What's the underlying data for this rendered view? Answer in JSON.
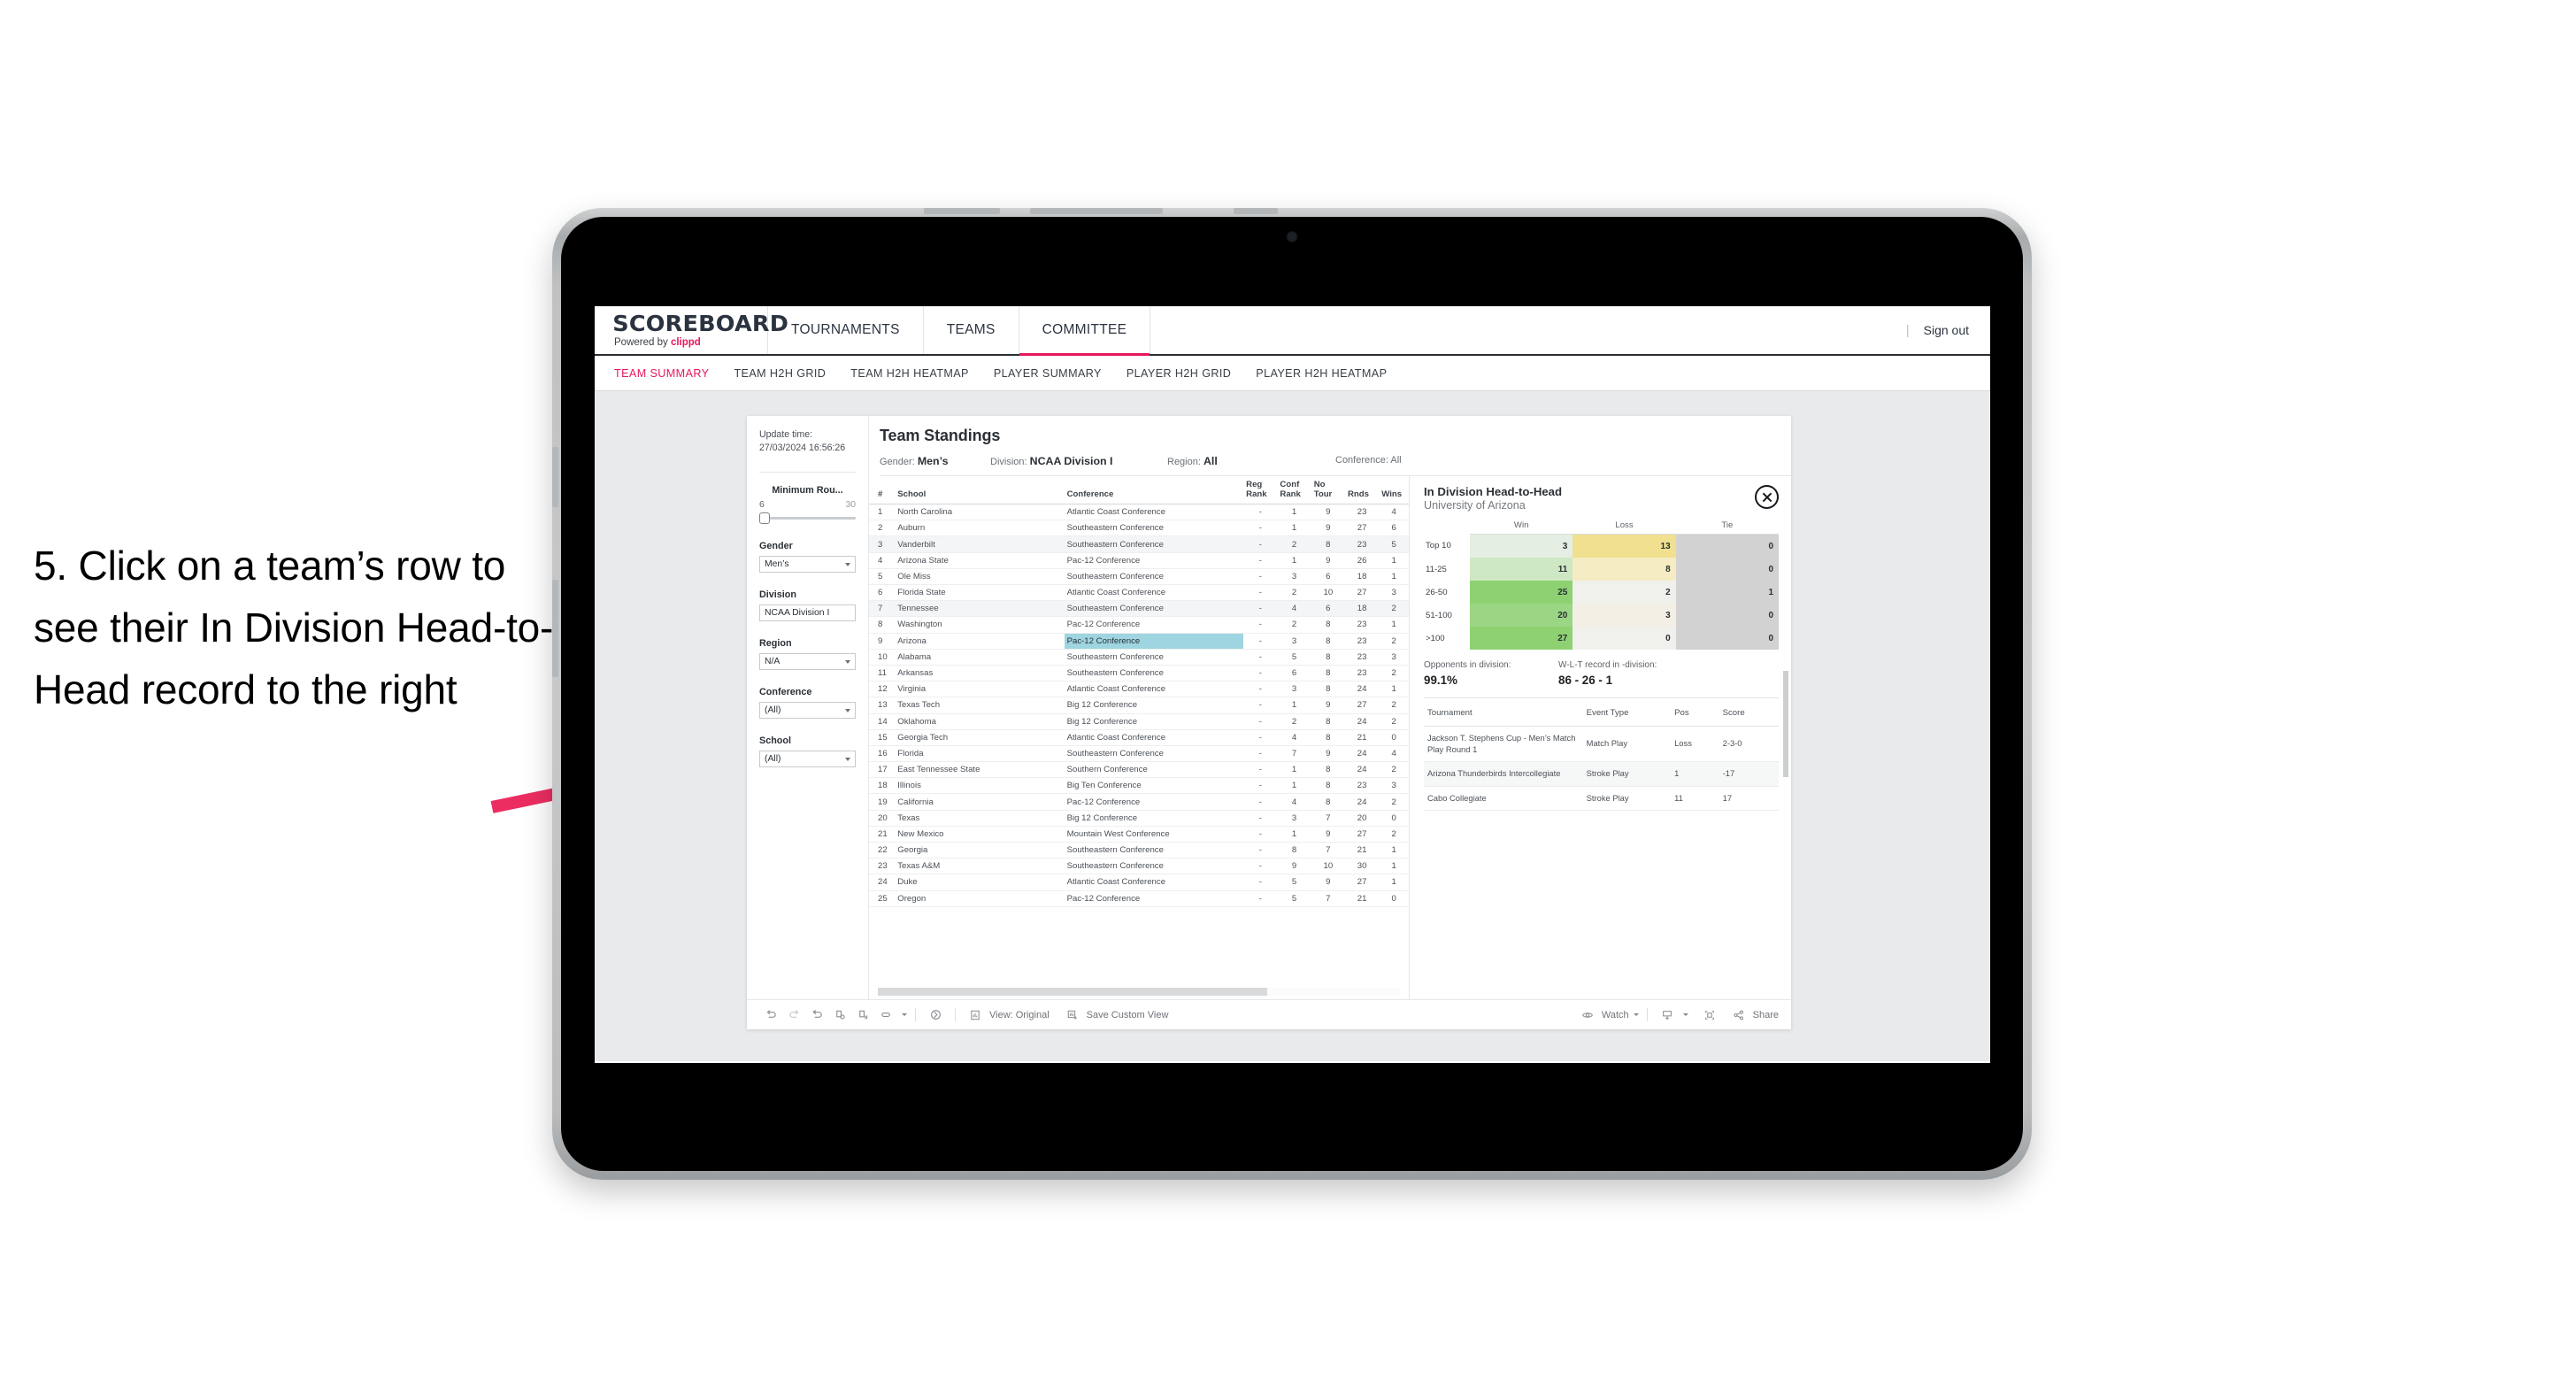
{
  "annotation": {
    "text": "5. Click on a team’s row to see their In Division Head-to-Head record to the right",
    "arrow_color": "#ec2d62"
  },
  "app": {
    "brand": {
      "name": "SCOREBOARD",
      "powered_prefix": "Powered by ",
      "powered_brand": "clippd"
    },
    "nav": [
      {
        "label": "TOURNAMENTS",
        "active": false
      },
      {
        "label": "TEAMS",
        "active": false
      },
      {
        "label": "COMMITTEE",
        "active": true
      }
    ],
    "nav_divider": "|",
    "sign_out": "Sign out",
    "subnav": [
      {
        "label": "TEAM SUMMARY",
        "active": true
      },
      {
        "label": "TEAM H2H GRID",
        "active": false
      },
      {
        "label": "TEAM H2H HEATMAP",
        "active": false
      },
      {
        "label": "PLAYER SUMMARY",
        "active": false
      },
      {
        "label": "PLAYER H2H GRID",
        "active": false
      },
      {
        "label": "PLAYER H2H HEATMAP",
        "active": false
      }
    ]
  },
  "rail": {
    "update_label": "Update time:",
    "update_value": "27/03/2024 16:56:26",
    "min_rounds": {
      "title": "Minimum Rou...",
      "min": "6",
      "max": "30"
    },
    "filters": [
      {
        "title": "Gender",
        "value": "Men’s",
        "caret": true
      },
      {
        "title": "Division",
        "value": "NCAA Division I",
        "caret": false
      },
      {
        "title": "Region",
        "value": "N/A",
        "caret": true
      },
      {
        "title": "Conference",
        "value": "(All)",
        "caret": true
      },
      {
        "title": "School",
        "value": "(All)",
        "caret": true
      }
    ]
  },
  "standings": {
    "title": "Team Standings",
    "filters": [
      {
        "key": "Gender:",
        "value": "Men’s"
      },
      {
        "key": "Division:",
        "value": "NCAA Division I"
      },
      {
        "key": "Region:",
        "value": "All"
      },
      {
        "key": "Conference:",
        "value": "All"
      }
    ],
    "columns": [
      "#",
      "School",
      "Conference",
      "Reg Rank",
      "Conf Rank",
      "No Tour",
      "Rnds",
      "Wins"
    ],
    "column_head_lines": [
      [
        "#"
      ],
      [
        "School"
      ],
      [
        "Conference"
      ],
      [
        "Reg",
        "Rank"
      ],
      [
        "Conf",
        "Rank"
      ],
      [
        "No",
        "Tour"
      ],
      [
        "Rnds"
      ],
      [
        "Wins"
      ]
    ],
    "selected_rank": 9,
    "rows": [
      {
        "rank": "1",
        "school": "North Carolina",
        "conference": "Atlantic Coast Conference",
        "reg_rank": "-",
        "conf_rank": "1",
        "no_tour": "9",
        "rnds": "23",
        "wins": "4"
      },
      {
        "rank": "2",
        "school": "Auburn",
        "conference": "Southeastern Conference",
        "reg_rank": "-",
        "conf_rank": "1",
        "no_tour": "9",
        "rnds": "27",
        "wins": "6"
      },
      {
        "rank": "3",
        "school": "Vanderbilt",
        "conference": "Southeastern Conference",
        "reg_rank": "-",
        "conf_rank": "2",
        "no_tour": "8",
        "rnds": "23",
        "wins": "5"
      },
      {
        "rank": "4",
        "school": "Arizona State",
        "conference": "Pac-12 Conference",
        "reg_rank": "-",
        "conf_rank": "1",
        "no_tour": "9",
        "rnds": "26",
        "wins": "1"
      },
      {
        "rank": "5",
        "school": "Ole Miss",
        "conference": "Southeastern Conference",
        "reg_rank": "-",
        "conf_rank": "3",
        "no_tour": "6",
        "rnds": "18",
        "wins": "1"
      },
      {
        "rank": "6",
        "school": "Florida State",
        "conference": "Atlantic Coast Conference",
        "reg_rank": "-",
        "conf_rank": "2",
        "no_tour": "10",
        "rnds": "27",
        "wins": "3"
      },
      {
        "rank": "7",
        "school": "Tennessee",
        "conference": "Southeastern Conference",
        "reg_rank": "-",
        "conf_rank": "4",
        "no_tour": "6",
        "rnds": "18",
        "wins": "2"
      },
      {
        "rank": "8",
        "school": "Washington",
        "conference": "Pac-12 Conference",
        "reg_rank": "-",
        "conf_rank": "2",
        "no_tour": "8",
        "rnds": "23",
        "wins": "1"
      },
      {
        "rank": "9",
        "school": "Arizona",
        "conference": "Pac-12 Conference",
        "reg_rank": "-",
        "conf_rank": "3",
        "no_tour": "8",
        "rnds": "23",
        "wins": "2"
      },
      {
        "rank": "10",
        "school": "Alabama",
        "conference": "Southeastern Conference",
        "reg_rank": "-",
        "conf_rank": "5",
        "no_tour": "8",
        "rnds": "23",
        "wins": "3"
      },
      {
        "rank": "11",
        "school": "Arkansas",
        "conference": "Southeastern Conference",
        "reg_rank": "-",
        "conf_rank": "6",
        "no_tour": "8",
        "rnds": "23",
        "wins": "2"
      },
      {
        "rank": "12",
        "school": "Virginia",
        "conference": "Atlantic Coast Conference",
        "reg_rank": "-",
        "conf_rank": "3",
        "no_tour": "8",
        "rnds": "24",
        "wins": "1"
      },
      {
        "rank": "13",
        "school": "Texas Tech",
        "conference": "Big 12 Conference",
        "reg_rank": "-",
        "conf_rank": "1",
        "no_tour": "9",
        "rnds": "27",
        "wins": "2"
      },
      {
        "rank": "14",
        "school": "Oklahoma",
        "conference": "Big 12 Conference",
        "reg_rank": "-",
        "conf_rank": "2",
        "no_tour": "8",
        "rnds": "24",
        "wins": "2"
      },
      {
        "rank": "15",
        "school": "Georgia Tech",
        "conference": "Atlantic Coast Conference",
        "reg_rank": "-",
        "conf_rank": "4",
        "no_tour": "8",
        "rnds": "21",
        "wins": "0"
      },
      {
        "rank": "16",
        "school": "Florida",
        "conference": "Southeastern Conference",
        "reg_rank": "-",
        "conf_rank": "7",
        "no_tour": "9",
        "rnds": "24",
        "wins": "4"
      },
      {
        "rank": "17",
        "school": "East Tennessee State",
        "conference": "Southern Conference",
        "reg_rank": "-",
        "conf_rank": "1",
        "no_tour": "8",
        "rnds": "24",
        "wins": "2"
      },
      {
        "rank": "18",
        "school": "Illinois",
        "conference": "Big Ten Conference",
        "reg_rank": "-",
        "conf_rank": "1",
        "no_tour": "8",
        "rnds": "23",
        "wins": "3"
      },
      {
        "rank": "19",
        "school": "California",
        "conference": "Pac-12 Conference",
        "reg_rank": "-",
        "conf_rank": "4",
        "no_tour": "8",
        "rnds": "24",
        "wins": "2"
      },
      {
        "rank": "20",
        "school": "Texas",
        "conference": "Big 12 Conference",
        "reg_rank": "-",
        "conf_rank": "3",
        "no_tour": "7",
        "rnds": "20",
        "wins": "0"
      },
      {
        "rank": "21",
        "school": "New Mexico",
        "conference": "Mountain West Conference",
        "reg_rank": "-",
        "conf_rank": "1",
        "no_tour": "9",
        "rnds": "27",
        "wins": "2"
      },
      {
        "rank": "22",
        "school": "Georgia",
        "conference": "Southeastern Conference",
        "reg_rank": "-",
        "conf_rank": "8",
        "no_tour": "7",
        "rnds": "21",
        "wins": "1"
      },
      {
        "rank": "23",
        "school": "Texas A&M",
        "conference": "Southeastern Conference",
        "reg_rank": "-",
        "conf_rank": "9",
        "no_tour": "10",
        "rnds": "30",
        "wins": "1"
      },
      {
        "rank": "24",
        "school": "Duke",
        "conference": "Atlantic Coast Conference",
        "reg_rank": "-",
        "conf_rank": "5",
        "no_tour": "9",
        "rnds": "27",
        "wins": "1"
      },
      {
        "rank": "25",
        "school": "Oregon",
        "conference": "Pac-12 Conference",
        "reg_rank": "-",
        "conf_rank": "5",
        "no_tour": "7",
        "rnds": "21",
        "wins": "0"
      }
    ]
  },
  "detail": {
    "title": "In Division Head-to-Head",
    "subtitle": "University of Arizona",
    "close_icon": "close-icon",
    "chart_data": {
      "type": "heatmap",
      "title": "In Division Head-to-Head",
      "subtitle": "University of Arizona",
      "columns": [
        "Win",
        "Loss",
        "Tie"
      ],
      "rows": [
        "Top 10",
        "11-25",
        "26-50",
        "51-100",
        ">100"
      ],
      "values": [
        [
          3,
          13,
          0
        ],
        [
          11,
          8,
          0
        ],
        [
          25,
          2,
          1
        ],
        [
          20,
          3,
          0
        ],
        [
          27,
          0,
          0
        ]
      ],
      "cell_colors": [
        [
          "#e4eee2",
          "#f0e08f",
          "#d2d2d2"
        ],
        [
          "#cfe8c4",
          "#f5ecc3",
          "#d2d2d2"
        ],
        [
          "#8ed173",
          "#f0f0ec",
          "#d2d2d2"
        ],
        [
          "#9bd684",
          "#f3efe5",
          "#d2d2d2"
        ],
        [
          "#8ed173",
          "#f0f0ec",
          "#d2d2d2"
        ]
      ],
      "legend": "none",
      "grid": false
    },
    "stats": [
      {
        "key": "Opponents in division:",
        "value": "99.1%"
      },
      {
        "key": "W-L-T record in -division:",
        "value": "86 - 26 - 1"
      }
    ],
    "tournaments": {
      "columns": [
        "Tournament",
        "Event Type",
        "Pos",
        "Score"
      ],
      "rows": [
        {
          "name": "Jackson T. Stephens Cup - Men’s Match Play Round 1",
          "event_type": "Match Play",
          "pos": "Loss",
          "score": "2-3-0"
        },
        {
          "name": "Arizona Thunderbirds Intercollegiate",
          "event_type": "Stroke Play",
          "pos": "1",
          "score": "-17"
        },
        {
          "name": "Cabo Collegiate",
          "event_type": "Stroke Play",
          "pos": "11",
          "score": "17"
        }
      ]
    }
  },
  "toolbar": {
    "icons": [
      "undo-icon",
      "redo-icon",
      "revert-icon",
      "refresh-data-icon",
      "pause-auto-update-icon",
      "shape-dropdown-icon",
      "presentation-mode-icon"
    ],
    "view_label": "View: Original",
    "save_label": "Save Custom View",
    "watch_label": "Watch",
    "share_label": "Share",
    "download_icon": "download-icon",
    "fullscreen_icon": "fullscreen-icon",
    "share_icon": "share-icon",
    "view_icon": "view-original-icon",
    "save_icon": "save-view-icon",
    "watch_icon": "watch-eye-icon"
  }
}
